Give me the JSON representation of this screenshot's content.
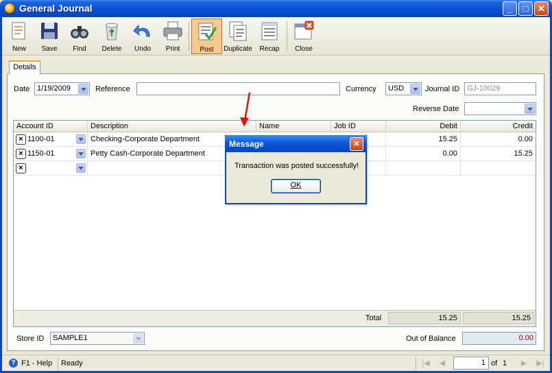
{
  "window": {
    "title": "General Journal",
    "min_label": "_",
    "max_label": "□",
    "close_label": "✕"
  },
  "toolbar": {
    "new": "New",
    "save": "Save",
    "find": "Find",
    "delete": "Delete",
    "undo": "Undo",
    "print": "Print",
    "post": "Post",
    "duplicate": "Duplicate",
    "recap": "Recap",
    "close": "Close"
  },
  "tabs": {
    "details": "Details"
  },
  "form": {
    "date_label": "Date",
    "date_value": "1/19/2009",
    "reference_label": "Reference",
    "reference_value": "",
    "currency_label": "Currency",
    "currency_value": "USD",
    "journal_id_label": "Journal ID",
    "journal_id_value": "GJ-10029",
    "reverse_date_label": "Reverse Date",
    "reverse_date_value": ""
  },
  "grid": {
    "columns": [
      "Account ID",
      "Description",
      "Name",
      "Job ID",
      "Debit",
      "Credit"
    ],
    "rows": [
      {
        "account": "1100-01",
        "description": "Checking-Corporate Department",
        "debit": "15.25",
        "credit": "0.00"
      },
      {
        "account": "1150-01",
        "description": "Petty Cash-Corporate Department",
        "debit": "0.00",
        "credit": "15.25"
      }
    ],
    "total_label": "Total",
    "total_debit": "15.25",
    "total_credit": "15.25"
  },
  "bottom": {
    "store_id_label": "Store ID",
    "store_id_value": "SAMPLE1",
    "out_of_balance_label": "Out of Balance",
    "out_of_balance_value": "0.00"
  },
  "status": {
    "help": "F1 - Help",
    "state": "Ready",
    "page_value": "1",
    "of_label": "of",
    "page_total": "1"
  },
  "dialog": {
    "title": "Message",
    "message": "Transaction was posted successfully!",
    "ok_label": "OK"
  },
  "colors": {
    "titlebar": "#0846c4",
    "accent": "#f2a33a",
    "arrow": "#e01010"
  }
}
